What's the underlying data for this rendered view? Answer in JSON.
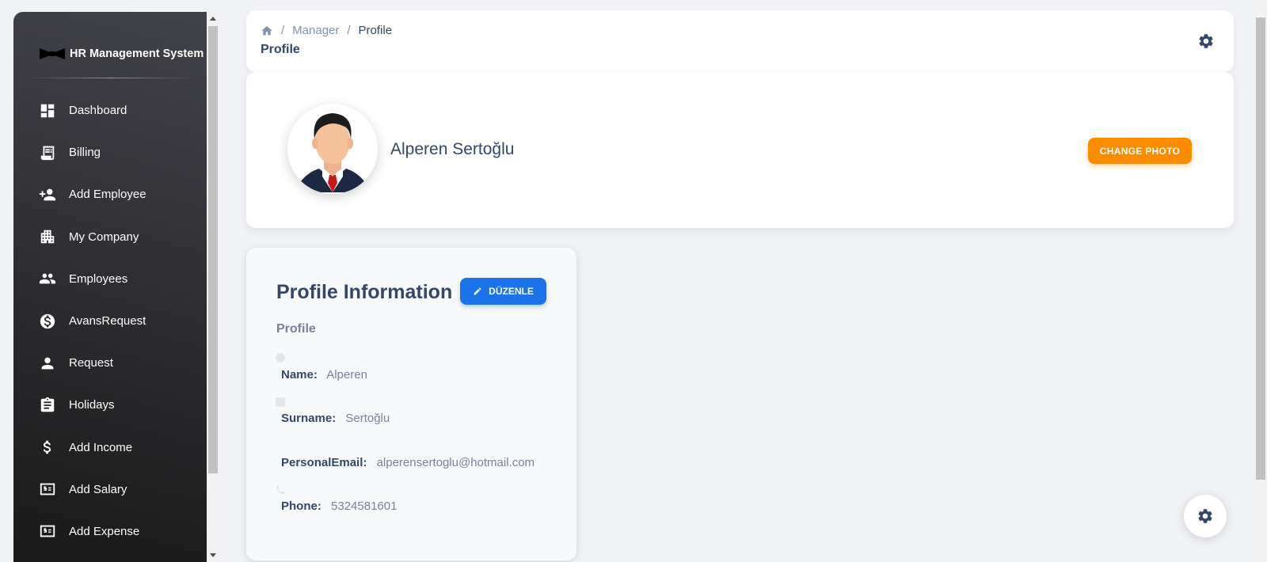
{
  "brand": {
    "title": "HR Management System",
    "icon": "bowtie-logo"
  },
  "sidebar": {
    "items": [
      {
        "label": "Dashboard",
        "icon": "dashboard-icon"
      },
      {
        "label": "Billing",
        "icon": "receipt-icon"
      },
      {
        "label": "Add Employee",
        "icon": "person-add-icon"
      },
      {
        "label": "My Company",
        "icon": "building-icon"
      },
      {
        "label": "Employees",
        "icon": "group-icon"
      },
      {
        "label": "AvansRequest",
        "icon": "dollar-circle-icon"
      },
      {
        "label": "Request",
        "icon": "person-icon"
      },
      {
        "label": "Holidays",
        "icon": "clipboard-icon"
      },
      {
        "label": "Add Income",
        "icon": "dollar-icon"
      },
      {
        "label": "Add Salary",
        "icon": "money-icon"
      },
      {
        "label": "Add Expense",
        "icon": "money-icon"
      }
    ]
  },
  "header": {
    "breadcrumb": [
      "Manager",
      "Profile"
    ],
    "title": "Profile"
  },
  "profile_header": {
    "name": "Alperen Sertoğlu",
    "change_photo_label": "CHANGE PHOTO"
  },
  "profile_info": {
    "title": "Profile Information",
    "edit_label": "DÜZENLE",
    "subtitle": "Profile",
    "fields": [
      {
        "label": "Name:",
        "value": "Alperen"
      },
      {
        "label": "Surname:",
        "value": "Sertoğlu"
      },
      {
        "label": "PersonalEmail:",
        "value": "alperensertoglu@hotmail.com"
      },
      {
        "label": "Phone:",
        "value": "5324581601"
      }
    ]
  },
  "colors": {
    "sidebar_gradient_top": "#42424a",
    "sidebar_gradient_bottom": "#191919",
    "primary_text": "#344767",
    "muted_text": "#7b809a",
    "warning": "#fb8c00",
    "info": "#1a73e8"
  }
}
